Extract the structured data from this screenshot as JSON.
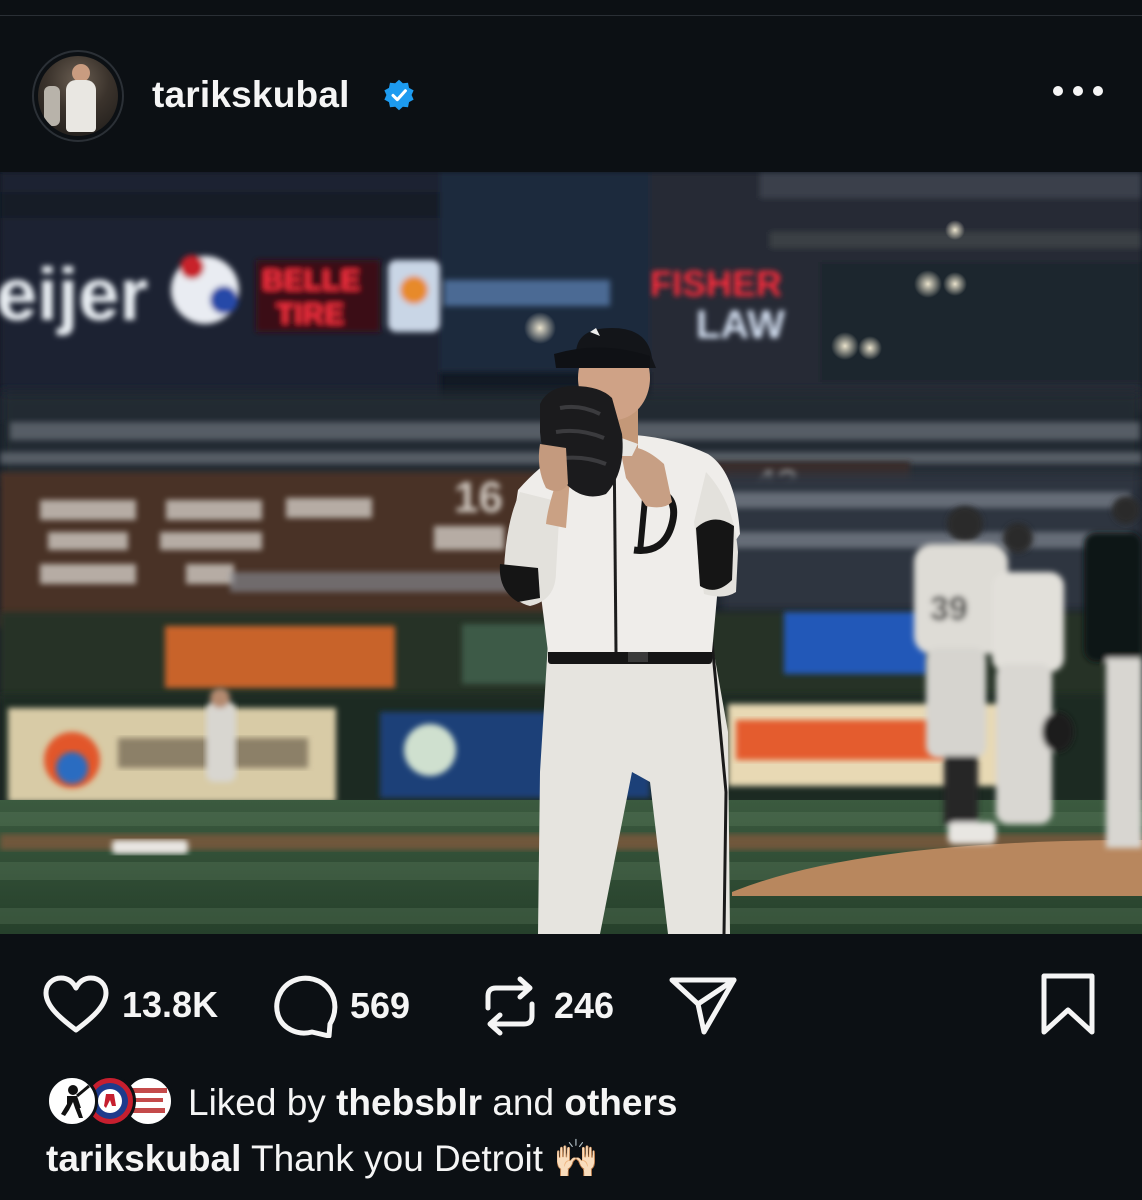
{
  "post": {
    "username": "tarikskubal",
    "verified": true,
    "more_icon": "ellipsis-icon"
  },
  "photo": {
    "signs": {
      "meijer": "eijer",
      "belle_1": "BELLE",
      "belle_2": "TIRE",
      "fisher_1": "FISHER",
      "fisher_2": "LAW",
      "number_1": "16",
      "number_2": "42",
      "jersey_number": "39"
    }
  },
  "actions": {
    "likes_count": "13.8K",
    "comments_count": "569",
    "reposts_count": "246"
  },
  "liked_by": {
    "prefix": "Liked by",
    "user": "thebsblr",
    "conjunction": "and",
    "others": "others"
  },
  "caption": {
    "username": "tarikskubal",
    "text": "Thank you Detroit",
    "emoji": "🙌🏻"
  },
  "colors": {
    "background": "#0c1014",
    "text": "#f5f5f5",
    "verified": "#1d9bf0"
  }
}
